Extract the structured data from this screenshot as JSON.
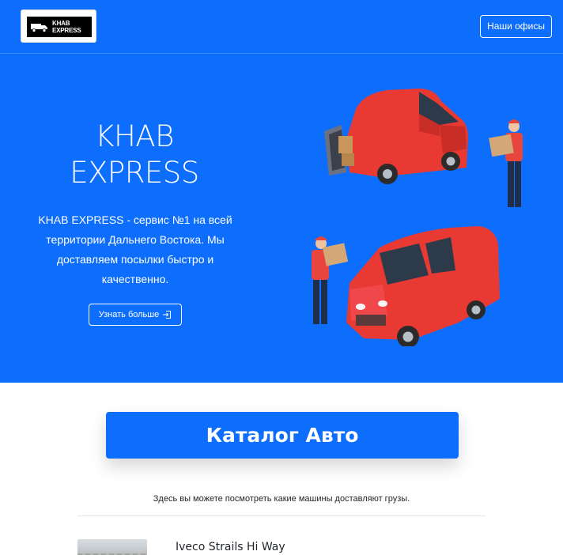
{
  "header": {
    "logo_text_line1": "KHAB",
    "logo_text_line2": "EXPRESS",
    "offices_button": "Наши офисы"
  },
  "hero": {
    "title_line1": "KHAB",
    "title_line2": "EXPRESS",
    "description": "KHAB EXPRESS - сервис №1 на всей территории Дальнего Востока. Мы доставляем посылки быстро и качественно.",
    "learn_more_button": "Узнать больше",
    "illustration": "delivery-vans-couriers-illustration"
  },
  "catalog": {
    "button_label": "Каталог Авто",
    "subtitle": "Здесь вы можете посмотреть какие машины доставляют грузы."
  },
  "cars": [
    {
      "name": "Iveco Strails Hi Way"
    }
  ],
  "colors": {
    "primary": "#0d6efd",
    "van_red": "#e83a32",
    "courier_red": "#e8453c",
    "text_dark": "#212529"
  }
}
